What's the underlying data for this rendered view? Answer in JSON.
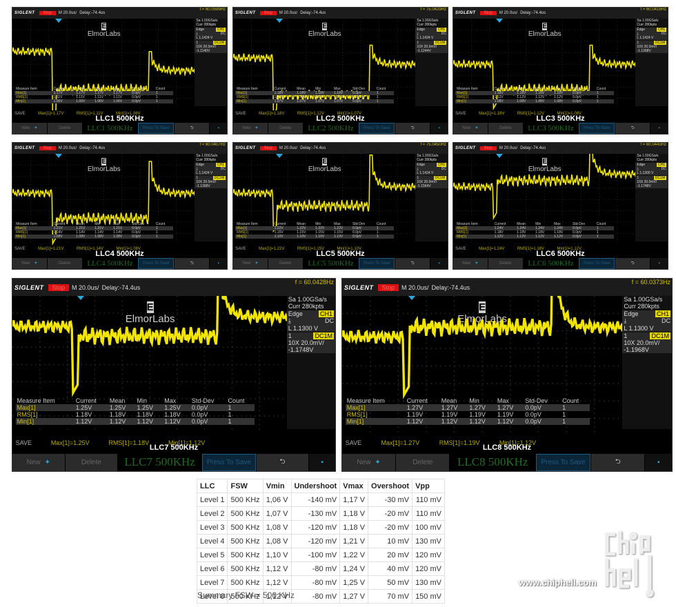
{
  "scopes": [
    {
      "id": "llc1",
      "brand": "SIGLENT",
      "status": "Stop",
      "timebase": "M 20.0us/",
      "delay": "Delay:-74.4us",
      "freq": "f = 60.0599Hz",
      "sa": "Sa 1.00GSa/s",
      "curr": "Curr 280kpts",
      "trig_type": "Edge",
      "trig_ch": "CH1",
      "coupling": "DC",
      "level": "L   1.1424 V",
      "ch_num": "1",
      "ch_mode": "DC1M",
      "probe": "10X 20.0mV/",
      "offset": "-1.1140V",
      "logo_text": "ElmorLabs",
      "logo_glyph": "E",
      "caption": "LLC1 500KHz",
      "name_field": "LLC1 500KHz",
      "measure": {
        "headers": [
          "Measure Item",
          "Current",
          "Mean",
          "Min",
          "Max",
          "Std-Dev",
          "Count"
        ],
        "rows": [
          [
            "Max[1]",
            "1.17V",
            "1.17V",
            "1.17V",
            "1.17V",
            "0.0pV",
            "1"
          ],
          [
            "RMS[1]",
            "1.11V",
            "1.11V",
            "1.11V",
            "1.11V",
            "0.0pV",
            "1"
          ],
          [
            "Min[1]",
            "1.06V",
            "1.06V",
            "1.06V",
            "1.06V",
            "0.0pV",
            "1"
          ]
        ]
      },
      "save": {
        "label": "SAVE",
        "max": "Max[1]=1.17V",
        "rms": "RMS[1]=1.11V",
        "min": "Min[1]=1.06V"
      },
      "buttons": {
        "new": "New",
        "delete": "Delete",
        "press": "Press To Save"
      },
      "wave": {
        "pre": 1.17,
        "min": 1.06,
        "post": 1.11,
        "peak": 1.17,
        "settle": 1.14
      }
    },
    {
      "id": "llc2",
      "brand": "SIGLENT",
      "status": "Stop",
      "timebase": "M 20.0us/",
      "delay": "Delay:-74.4us",
      "freq": "f = 75.0429Hz",
      "sa": "Sa 1.00GSa/s",
      "curr": "Curr 280kpts",
      "trig_type": "Edge",
      "trig_ch": "CH1",
      "coupling": "DC",
      "level": "L   1.1424 V",
      "ch_num": "1",
      "ch_mode": "DC1M",
      "probe": "10X 20.0mV/",
      "offset": "-1.1244V",
      "logo_text": "ElmorLabs",
      "logo_glyph": "E",
      "caption": "LLC2 500KHz",
      "name_field": "LLC2 500KHz",
      "measure": {
        "headers": [
          "Measure Item",
          "Current",
          "Mean",
          "Min",
          "Max",
          "Std-Dev",
          "Count"
        ],
        "rows": [
          [
            "Max[1]",
            "1.18V",
            "1.18V",
            "1.18V",
            "1.18V",
            "0.0pV",
            "1"
          ],
          [
            "RMS[1]",
            "1.12V",
            "1.12V",
            "1.12V",
            "1.12V",
            "0.0pV",
            "1"
          ],
          [
            "Min[1]",
            "1.07V",
            "1.07V",
            "1.07V",
            "1.07V",
            "0.0pV",
            "1"
          ]
        ]
      },
      "save": {
        "label": "SAVE",
        "max": "Max[1]=1.18V",
        "rms": "RMS[1]=1.12V",
        "min": "Min[1]=1.07V"
      },
      "buttons": {
        "new": "New",
        "delete": "Delete",
        "press": "Press To Save"
      },
      "wave": {
        "pre": 1.16,
        "min": 1.07,
        "post": 1.1,
        "peak": 1.18,
        "settle": 1.15
      }
    },
    {
      "id": "llc3",
      "brand": "SIGLENT",
      "status": "Stop",
      "timebase": "M 20.0us/",
      "delay": "Delay:-74.4us",
      "freq": "f = 60.0416Hz",
      "sa": "Sa 1.00GSa/s",
      "curr": "Curr 280kpts",
      "trig_type": "Edge",
      "trig_ch": "CH1",
      "coupling": "DC",
      "level": "L   1.1424 V",
      "ch_num": "1",
      "ch_mode": "DC1M",
      "probe": "10X 20.0mV/",
      "offset": "-1.1308V",
      "logo_text": "ElmorLabs",
      "logo_glyph": "E",
      "caption": "LLC3 500KHz",
      "name_field": "LLC3 500KHz",
      "measure": {
        "headers": [
          "Measure Item",
          "Current",
          "Mean",
          "Min",
          "Max",
          "Std-Dev",
          "Count"
        ],
        "rows": [
          [
            "Max[1]",
            "1.18V",
            "1.18V",
            "1.18V",
            "1.18V",
            "0.0pV",
            "1"
          ],
          [
            "RMS[1]",
            "1.12V",
            "1.12V",
            "1.12V",
            "1.12V",
            "0.0pV",
            "1"
          ],
          [
            "Min[1]",
            "1.08V",
            "1.08V",
            "1.08V",
            "1.08V",
            "0.0pV",
            "1"
          ]
        ]
      },
      "save": {
        "label": "SAVE",
        "max": "Max[1]=1.18V",
        "rms": "RMS[1]=1.12V",
        "min": "Min[1]=1.08V"
      },
      "buttons": {
        "new": "New",
        "delete": "Delete",
        "press": "Press To Save"
      },
      "wave": {
        "pre": 1.15,
        "min": 1.08,
        "post": 1.11,
        "peak": 1.18,
        "settle": 1.15
      }
    },
    {
      "id": "llc4",
      "brand": "SIGLENT",
      "status": "Stop",
      "timebase": "M 20.0us/",
      "delay": "Delay:-74.4us",
      "freq": "f = 60.0407Hz",
      "sa": "Sa 1.00GSa/s",
      "curr": "Curr 280kpts",
      "trig_type": "Edge",
      "trig_ch": "CH1",
      "coupling": "DC",
      "level": "L   1.1424 V",
      "ch_num": "1",
      "ch_mode": "DC1M",
      "probe": "10X 20.0mV/",
      "offset": "-1.1308V",
      "logo_text": "ElmorLabs",
      "logo_glyph": "E",
      "caption": "LLC4 500KHz",
      "name_field": "LLC4 500KHz",
      "measure": {
        "headers": [
          "Measure Item",
          "Current",
          "Mean",
          "Min",
          "Max",
          "Std-Dev",
          "Count"
        ],
        "rows": [
          [
            "Max[1]",
            "1.21V",
            "1.21V",
            "1.21V",
            "1.21V",
            "0.0pV",
            "1"
          ],
          [
            "RMS[1]",
            "1.14V",
            "1.14V",
            "1.14V",
            "1.14V",
            "0.0pV",
            "1"
          ],
          [
            "Min[1]",
            "1.08V",
            "1.08V",
            "1.08V",
            "1.08V",
            "0.0pV",
            "1"
          ]
        ]
      },
      "save": {
        "label": "SAVE",
        "max": "Max[1]=1.21V",
        "rms": "RMS[1]=1.14V",
        "min": "Min[1]=1.08V"
      },
      "buttons": {
        "new": "New",
        "delete": "Delete",
        "press": "Press To Save"
      },
      "wave": {
        "pre": 1.16,
        "min": 1.08,
        "post": 1.12,
        "peak": 1.21,
        "settle": 1.16
      }
    },
    {
      "id": "llc5",
      "brand": "SIGLENT",
      "status": "Stop",
      "timebase": "M 20.0us/",
      "delay": "Delay:-74.4us",
      "freq": "f = 75.0450Hz",
      "sa": "Sa 1.00GSa/s",
      "curr": "Curr 280kpts",
      "trig_type": "Edge",
      "trig_ch": "CH1",
      "coupling": "DC",
      "level": "L   1.1424 V",
      "ch_num": "1",
      "ch_mode": "DC1M",
      "probe": "10X 20.0mV/",
      "offset": "-1.1564V",
      "logo_text": "ElmorLabs",
      "logo_glyph": "E",
      "caption": "LLC5 500KHz",
      "name_field": "LLC5 500KHz",
      "measure": {
        "headers": [
          "Measure Item",
          "Current",
          "Mean",
          "Min",
          "Max",
          "Std-Dev",
          "Count"
        ],
        "rows": [
          [
            "Max[1]",
            "1.22V",
            "1.22V",
            "1.22V",
            "1.22V",
            "0.0pV",
            "1"
          ],
          [
            "RMS[1]",
            "1.15V",
            "1.15V",
            "1.15V",
            "1.15V",
            "0.0pV",
            "1"
          ],
          [
            "Min[1]",
            "1.10V",
            "1.10V",
            "1.10V",
            "1.10V",
            "0.0pV",
            "1"
          ]
        ]
      },
      "save": {
        "label": "SAVE",
        "max": "Max[1]=1.22V",
        "rms": "RMS[1]=1.15V",
        "min": "Min[1]=1.10V"
      },
      "buttons": {
        "new": "New",
        "delete": "Delete",
        "press": "Press To Save"
      },
      "wave": {
        "pre": 1.16,
        "min": 1.1,
        "post": 1.14,
        "peak": 1.22,
        "settle": 1.17
      }
    },
    {
      "id": "llc6",
      "brand": "SIGLENT",
      "status": "Stop",
      "timebase": "M 20.0us/",
      "delay": "Delay:-74.4us",
      "freq": "f = 60.0443Hz",
      "sa": "Sa 1.00GSa/s",
      "curr": "Curr 280kpts",
      "trig_type": "Edge",
      "trig_ch": "CH1",
      "coupling": "DC",
      "level": "L   1.1300 V",
      "ch_num": "1",
      "ch_mode": "DC1M",
      "probe": "10X 20.0mV/",
      "offset": "-1.1748V",
      "logo_text": "ElmorLabs",
      "logo_glyph": "E",
      "caption": "LLC6 500KHz",
      "name_field": "LLC6 500KHz",
      "measure": {
        "headers": [
          "Measure Item",
          "Current",
          "Mean",
          "Min",
          "Max",
          "Std-Dev",
          "Count"
        ],
        "rows": [
          [
            "Max[1]",
            "1.24V",
            "1.24V",
            "1.24V",
            "1.24V",
            "0.0pV",
            "1"
          ],
          [
            "RMS[1]",
            "1.18V",
            "1.18V",
            "1.18V",
            "1.18V",
            "0.0pV",
            "1"
          ],
          [
            "Min[1]",
            "1.12V",
            "1.12V",
            "1.12V",
            "1.12V",
            "0.0pV",
            "1"
          ]
        ]
      },
      "save": {
        "label": "SAVE",
        "max": "Max[1]=1.24V",
        "rms": "RMS[1]=1.18V",
        "min": "Min[1]=1.12V"
      },
      "buttons": {
        "new": "New",
        "delete": "Delete",
        "press": "Press To Save"
      },
      "wave": {
        "pre": 1.17,
        "min": 1.12,
        "post": 1.18,
        "peak": 1.24,
        "settle": 1.19
      }
    },
    {
      "id": "llc7",
      "brand": "SIGLENT",
      "status": "Stop",
      "timebase": "M 20.0us/",
      "delay": "Delay:-74.4us",
      "freq": "f = 60.0428Hz",
      "sa": "Sa 1.00GSa/s",
      "curr": "Curr 280kpts",
      "trig_type": "Edge",
      "trig_ch": "CH1",
      "coupling": "DC",
      "level": "L   1.1300 V",
      "ch_num": "1",
      "ch_mode": "DC1M",
      "probe": "10X 20.0mV/",
      "offset": "-1.1748V",
      "logo_text": "ElmorLabs",
      "logo_glyph": "E",
      "caption": "LLC7 500KHz",
      "name_field": "LLC7 500KHz",
      "measure": {
        "headers": [
          "Measure Item",
          "Current",
          "Mean",
          "Min",
          "Max",
          "Std-Dev",
          "Count"
        ],
        "rows": [
          [
            "Max[1]",
            "1.25V",
            "1.25V",
            "1.25V",
            "1.25V",
            "0.0pV",
            "1"
          ],
          [
            "RMS[1]",
            "1.18V",
            "1.18V",
            "1.18V",
            "1.18V",
            "0.0pV",
            "1"
          ],
          [
            "Min[1]",
            "1.12V",
            "1.12V",
            "1.12V",
            "1.12V",
            "0.0pV",
            "1"
          ]
        ]
      },
      "save": {
        "label": "SAVE",
        "max": "Max[1]=1.25V",
        "rms": "RMS[1]=1.18V",
        "min": "Min[1]=1.12V"
      },
      "buttons": {
        "new": "New",
        "delete": "Delete",
        "press": "Press To Save"
      },
      "wave": {
        "pre": 1.19,
        "min": 1.12,
        "post": 1.18,
        "peak": 1.25,
        "settle": 1.2
      }
    },
    {
      "id": "llc8",
      "brand": "SIGLENT",
      "status": "Stop",
      "timebase": "M 20.0us/",
      "delay": "Delay:-74.4us",
      "freq": "f = 60.0373Hz",
      "sa": "Sa 1.00GSa/s",
      "curr": "Curr 280kpts",
      "trig_type": "Edge",
      "trig_ch": "CH1",
      "coupling": "DC",
      "level": "L   1.1300 V",
      "ch_num": "1",
      "ch_mode": "DC1M",
      "probe": "10X 20.0mV/",
      "offset": "-1.1968V",
      "logo_text": "ElmorLabs",
      "logo_glyph": "E",
      "caption": "LLC8 500KHz",
      "name_field": "LLC8 500KHz",
      "measure": {
        "headers": [
          "Measure Item",
          "Current",
          "Mean",
          "Min",
          "Max",
          "Std-Dev",
          "Count"
        ],
        "rows": [
          [
            "Max[1]",
            "1.27V",
            "1.27V",
            "1.27V",
            "1.27V",
            "0.0pV",
            "1"
          ],
          [
            "RMS[1]",
            "1.19V",
            "1.19V",
            "1.19V",
            "1.19V",
            "0.0pV",
            "1"
          ],
          [
            "Min[1]",
            "1.12V",
            "1.12V",
            "1.12V",
            "1.12V",
            "0.0pV",
            "1"
          ]
        ]
      },
      "save": {
        "label": "SAVE",
        "max": "Max[1]=1.27V",
        "rms": "RMS[1]=1.19V",
        "min": "Min[1]=1.12V"
      },
      "buttons": {
        "new": "New",
        "delete": "Delete",
        "press": "Press To Save"
      },
      "wave": {
        "pre": 1.18,
        "min": 1.12,
        "post": 1.19,
        "peak": 1.27,
        "settle": 1.19
      }
    }
  ],
  "summary": {
    "headers": [
      "LLC",
      "FSW",
      "Vmin",
      "Undershoot",
      "Vmax",
      "Overshoot",
      "Vpp"
    ],
    "rows": [
      [
        "Level 1",
        "500 KHz",
        "1,06 V",
        "-140 mV",
        "1,17 V",
        "-30 mV",
        "110 mV"
      ],
      [
        "Level 2",
        "500 KHz",
        "1,07 V",
        "-130 mV",
        "1,18 V",
        "-20 mV",
        "110 mV"
      ],
      [
        "Level 3",
        "500 KHz",
        "1,08 V",
        "-120 mV",
        "1,18 V",
        "-20 mV",
        "100 mV"
      ],
      [
        "Level 4",
        "500 KHz",
        "1,08 V",
        "-120 mV",
        "1,21 V",
        "10 mV",
        "130 mV"
      ],
      [
        "Level 5",
        "500 KHz",
        "1,10 V",
        "-100 mV",
        "1,22 V",
        "20 mV",
        "120 mV"
      ],
      [
        "Level 6",
        "500 KHz",
        "1,12 V",
        "-80 mV",
        "1,24 V",
        "40 mV",
        "120 mV"
      ],
      [
        "Level 7",
        "500 KHz",
        "1,12 V",
        "-80 mV",
        "1,25 V",
        "50 mV",
        "130 mV"
      ],
      [
        "Level 8",
        "500 KHz",
        "1,12 V",
        "-80 mV",
        "1,27 V",
        "70 mV",
        "150 mV"
      ]
    ],
    "caption": "Summary FSW = 500 KHz"
  },
  "watermark": {
    "url": "www.chiphell.com",
    "logo_text": "chip hell"
  },
  "colors": {
    "trace": "#f2e600",
    "brand_stop": "#dd1111",
    "trigger_marker": "#29a8e0",
    "scope_bg": "#000000"
  }
}
